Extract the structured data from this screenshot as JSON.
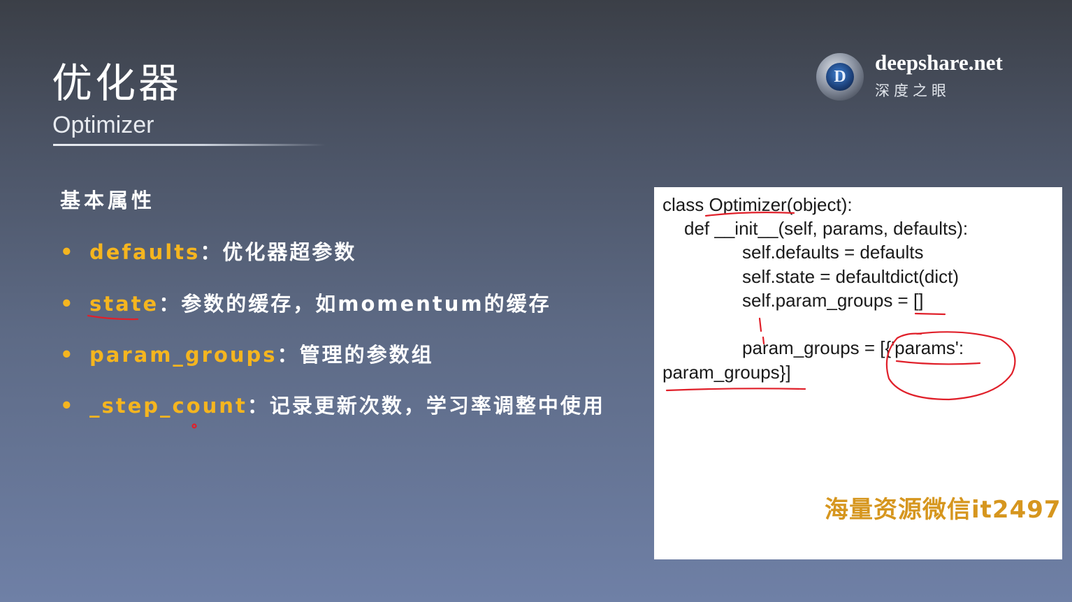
{
  "slide": {
    "title": "优化器",
    "subtitle": "Optimizer"
  },
  "brand": {
    "logo_letter": "D",
    "name": "deepshare.net",
    "tagline": "深度之眼"
  },
  "section": {
    "heading": "基本属性",
    "bullet_symbol": "•",
    "items": [
      {
        "keyword": "defaults",
        "desc": "：优化器超参数"
      },
      {
        "keyword": "state",
        "desc": "：参数的缓存，如momentum的缓存"
      },
      {
        "keyword": "param_groups",
        "desc": "：管理的参数组"
      },
      {
        "keyword": "_step_count",
        "desc": "：记录更新次数，学习率调整中使用"
      }
    ]
  },
  "code": {
    "lines": [
      "class Optimizer(object):",
      "def __init__(self, params, defaults):",
      "self.defaults = defaults",
      "self.state = defaultdict(dict)",
      "self.param_groups = []",
      "param_groups = [{'params':",
      "param_groups}]"
    ]
  },
  "watermark": "海量资源微信it2497",
  "colors": {
    "keyword": "#f5b51f",
    "annotation_ink": "#e0202a",
    "watermark": "#d6961e"
  }
}
